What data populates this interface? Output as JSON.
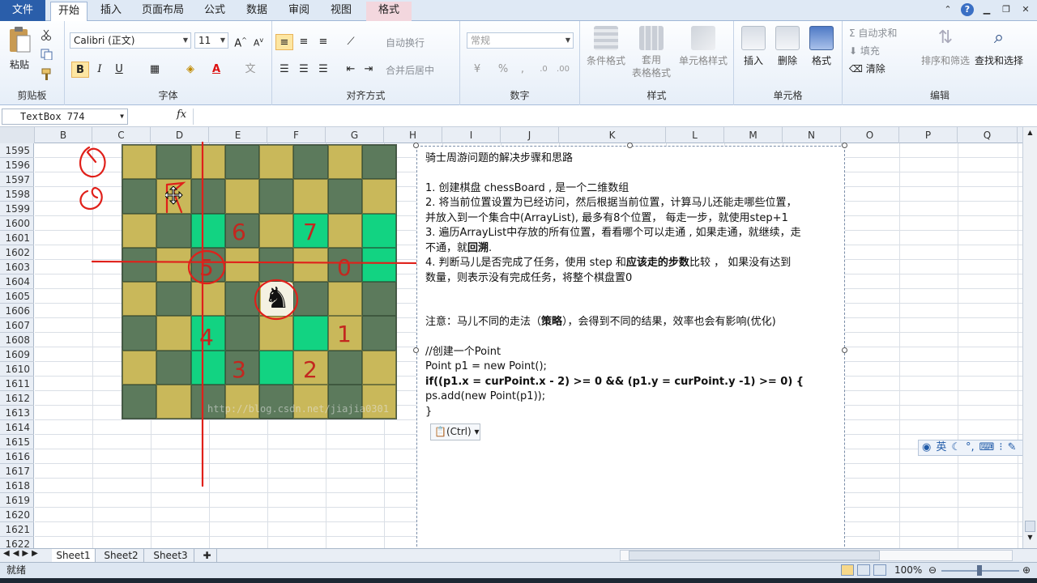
{
  "tabs": [
    {
      "label": "文件"
    },
    {
      "label": "开始"
    },
    {
      "label": "插入"
    },
    {
      "label": "页面布局"
    },
    {
      "label": "公式"
    },
    {
      "label": "数据"
    },
    {
      "label": "审阅"
    },
    {
      "label": "视图"
    },
    {
      "label": "格式"
    }
  ],
  "ribbon": {
    "clipboard": {
      "label": "剪贴板",
      "paste": "粘贴"
    },
    "font": {
      "label": "字体",
      "name": "Calibri (正文)",
      "size": "11",
      "bold": "B",
      "italic": "I",
      "underline": "U"
    },
    "align": {
      "label": "对齐方式",
      "wrap": "自动换行",
      "merge": "合并后居中"
    },
    "number": {
      "label": "数字",
      "format": "常规",
      "percent": "%",
      "comma": ","
    },
    "styles": {
      "label": "样式",
      "cond": "条件格式",
      "table": "套用\n表格格式",
      "cell": "单元格样式"
    },
    "cells": {
      "label": "单元格",
      "insert": "插入",
      "delete": "删除",
      "format": "格式"
    },
    "edit": {
      "label": "编辑",
      "autosum": "自动求和",
      "fill": "填充",
      "clear": "清除",
      "sort": "排序和筛选",
      "find": "查找和选择"
    }
  },
  "formula_bar": {
    "name_box": "TextBox 774",
    "fx": "fx"
  },
  "columns": [
    "B",
    "C",
    "D",
    "E",
    "F",
    "G",
    "H",
    "I",
    "J",
    "K",
    "L",
    "M",
    "N",
    "O",
    "P",
    "Q"
  ],
  "rows": [
    "1595",
    "1596",
    "1597",
    "1598",
    "1599",
    "1600",
    "1601",
    "1602",
    "1603",
    "1604",
    "1605",
    "1606",
    "1607",
    "1608",
    "1609",
    "1610",
    "1611",
    "1612",
    "1613",
    "1614",
    "1615",
    "1616",
    "1617",
    "1618",
    "1619",
    "1620",
    "1621",
    "1622"
  ],
  "board": {
    "rows": [
      "ldldldld",
      "dldldldl",
      "ldgdlglg",
      "dldldldg",
      "ldldldld",
      "dlgdlgld",
      "ldgdgldl",
      "dldldldl"
    ],
    "labels": {
      "m6": "6",
      "m7": "7",
      "m5": "5",
      "m0": "0",
      "m4": "4",
      "m1": "1",
      "m3": "3",
      "m2": "2"
    },
    "knight": "♞",
    "watermark": "http://blog.csdn.net/jiajia0301"
  },
  "textbox": {
    "title": "骑士周游问题的解决步骤和思路",
    "step1": "1. 创建棋盘 chessBoard , 是一个二维数组",
    "step2a": "2. 将当前位置设置为已经访问，然后根据当前位置，计算马儿还能走哪些位置，",
    "step2b": "并放入到一个集合中(ArrayList), 最多有8个位置， 每走一步，就使用step+1",
    "step3a": "3. 遍历ArrayList中存放的所有位置，看看哪个可以走通 , 如果走通，就继续，走",
    "step3b_pre": "不通，就",
    "step3b_bold": "回溯",
    "step3b_post": ".",
    "step4a_pre": "4. 判断马儿是否完成了任务，使用 step 和",
    "step4a_bold": "应该走的步数",
    "step4a_post": "比较 ， 如果没有达到",
    "step4b": "数量，则表示没有完成任务，将整个棋盘置0",
    "note_pre": "注意：马儿不同的走法（",
    "note_bold": "策略",
    "note_post": "），会得到不同的结果，效率也会有影响(优化)",
    "code1": "//创建一个Point",
    "code2": "Point p1 = new Point();",
    "code3": "if((p1.x = curPoint.x - 2) >= 0 && (p1.y = curPoint.y -1) >= 0) {",
    "code4": "ps.add(new Point(p1));",
    "code5": "}"
  },
  "paste_tag": "(Ctrl)",
  "ime": {
    "lang": "英"
  },
  "sheets": [
    "Sheet1",
    "Sheet2",
    "Sheet3"
  ],
  "status": {
    "ready": "就绪",
    "zoom": "100%"
  },
  "colors": {
    "file_tab": "#2a5eaa",
    "dark_square": "#5c7a5c",
    "light_square": "#c9b85a",
    "move_square": "#12d382",
    "annotation": "#e0201a"
  }
}
